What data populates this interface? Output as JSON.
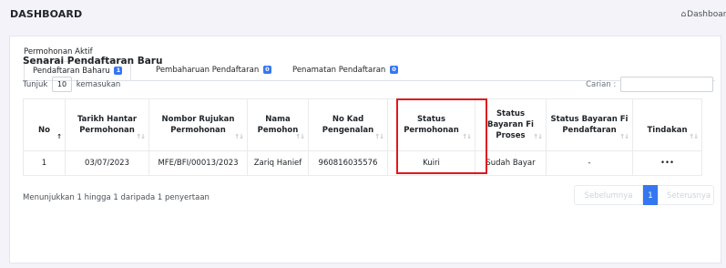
{
  "header": {
    "title": "DASHBOARD",
    "breadcrumb": "Dashboard",
    "breadcrumb_icon": "home-icon"
  },
  "card": {
    "title": "Permohonan Aktif",
    "tabs": [
      {
        "label": "Pendaftaran Baharu",
        "badge": "1",
        "active": true
      },
      {
        "label": "Pembaharuan Pendaftaran",
        "badge": "0",
        "active": false
      },
      {
        "label": "Penamatan Pendaftaran",
        "badge": "0",
        "active": false
      }
    ]
  },
  "list": {
    "title": "Senarai Pendaftaran Baru",
    "length_prefix": "Tunjuk",
    "length_value": "10",
    "length_suffix": "kemasukan",
    "search_label": "Carian :",
    "columns": [
      "No",
      "Tarikh Hantar Permohonan",
      "Nombor Rujukan Permohonan",
      "Nama Pemohon",
      "No Kad Pengenalan",
      "Status Permohonan",
      "Status Bayaran Fi Proses",
      "Status Bayaran Fi Pendaftaran",
      "Tindakan"
    ],
    "rows": [
      [
        "1",
        "03/07/2023",
        "MFE/BFI/00013/2023",
        "Zariq Hanief",
        "960816035576",
        "Kuiri",
        "Sudah Bayar",
        "-",
        "•••"
      ]
    ],
    "info": "Menunjukkan 1 hingga 1 daripada 1 penyertaan",
    "pager": {
      "prev": "Sebelumnya",
      "current": "1",
      "next": "Seterusnya"
    }
  },
  "colors": {
    "accent": "#3577f1",
    "highlight": "#e0181b"
  }
}
